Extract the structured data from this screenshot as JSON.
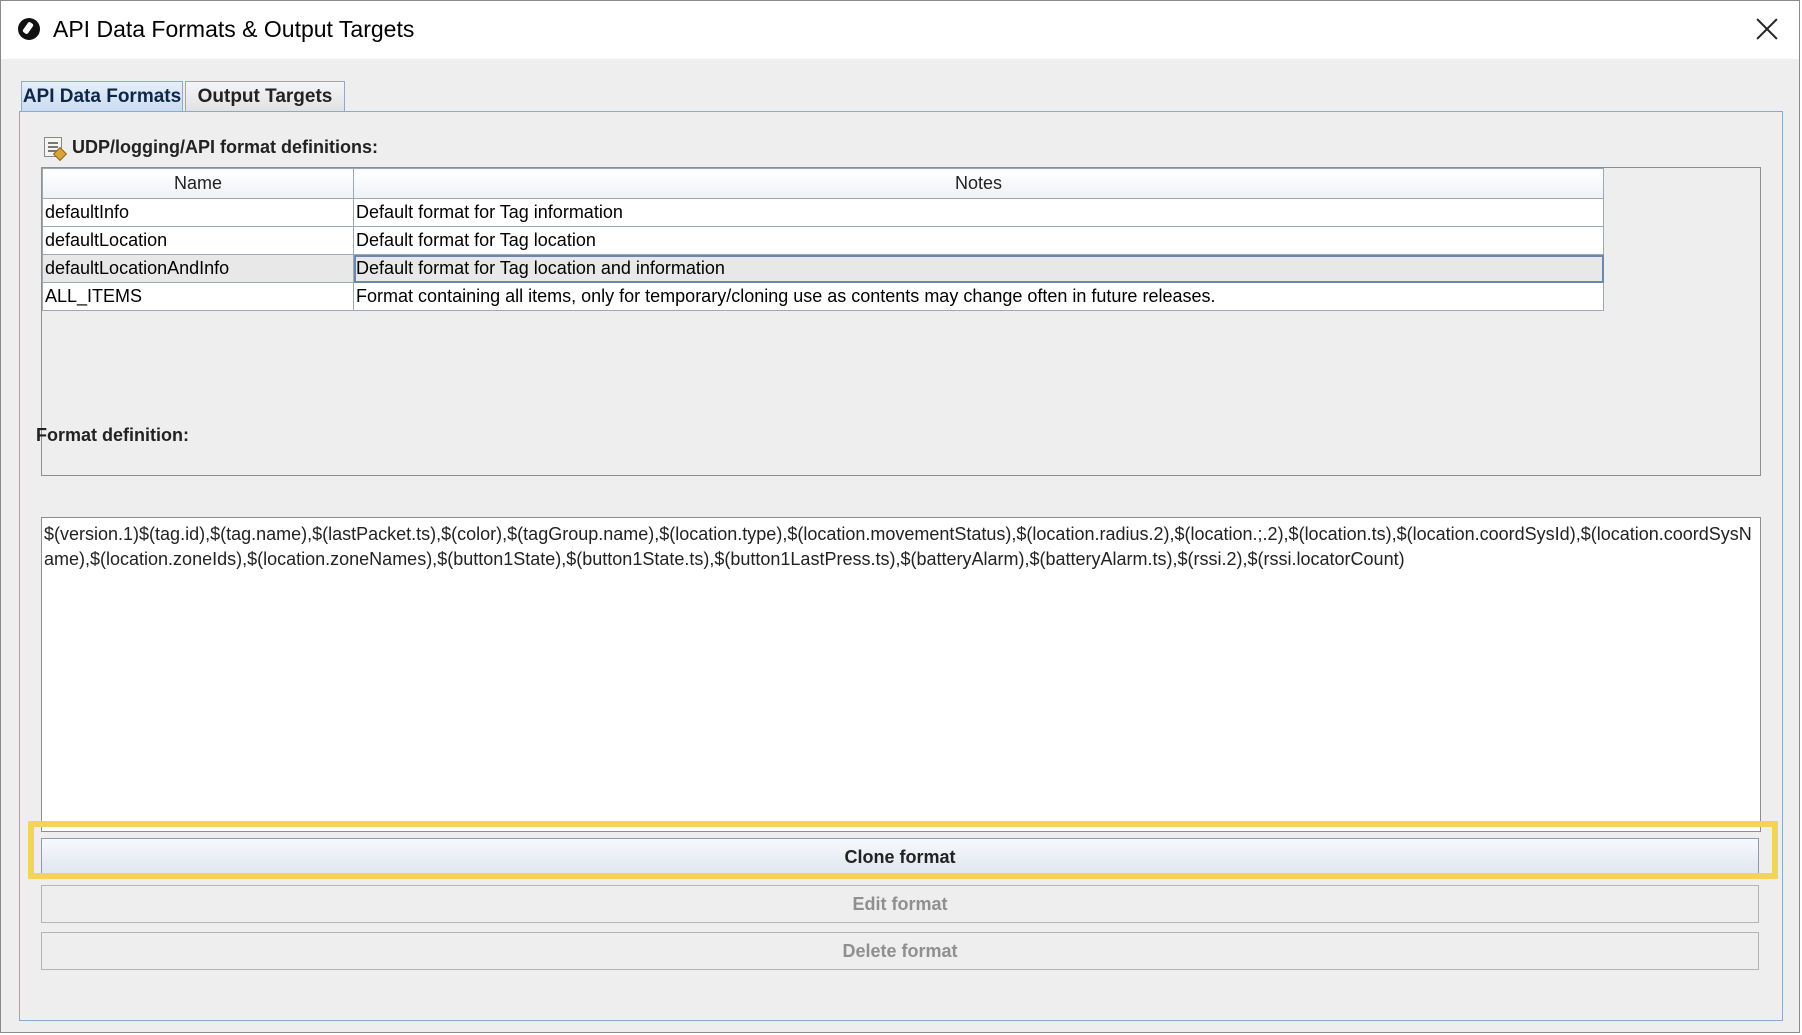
{
  "window": {
    "title": "API Data Formats & Output Targets"
  },
  "tabs": [
    {
      "label": "API Data Formats",
      "active": true
    },
    {
      "label": "Output Targets",
      "active": false
    }
  ],
  "formats_section": {
    "label": "UDP/logging/API format definitions:",
    "icon": "document-edit-icon",
    "columns": [
      "Name",
      "Notes"
    ],
    "rows": [
      {
        "name": "defaultInfo",
        "notes": "Default format for Tag information"
      },
      {
        "name": "defaultLocation",
        "notes": "Default format for Tag location"
      },
      {
        "name": "defaultLocationAndInfo",
        "notes": "Default format for Tag location and information",
        "selected": true
      },
      {
        "name": "ALL_ITEMS",
        "notes": "Format containing all items, only for temporary/cloning use as contents may change often in future releases."
      }
    ]
  },
  "definition_section": {
    "label": "Format definition:",
    "value": "$(version.1)$(tag.id),$(tag.name),$(lastPacket.ts),$(color),$(tagGroup.name),$(location.type),$(location.movementStatus),$(location.radius.2),$(location.;.2),$(location.ts),$(location.coordSysId),$(location.coordSysName),$(location.zoneIds),$(location.zoneNames),$(button1State),$(button1State.ts),$(button1LastPress.ts),$(batteryAlarm),$(batteryAlarm.ts),$(rssi.2),$(rssi.locatorCount)"
  },
  "buttons": {
    "clone": {
      "label": "Clone format",
      "enabled": true
    },
    "edit": {
      "label": "Edit format",
      "enabled": false
    },
    "delete": {
      "label": "Delete format",
      "enabled": false
    }
  },
  "colors": {
    "highlight": "#f5d35a",
    "tab_active": "#c9daf0",
    "border_blue": "#8fa9c8"
  }
}
